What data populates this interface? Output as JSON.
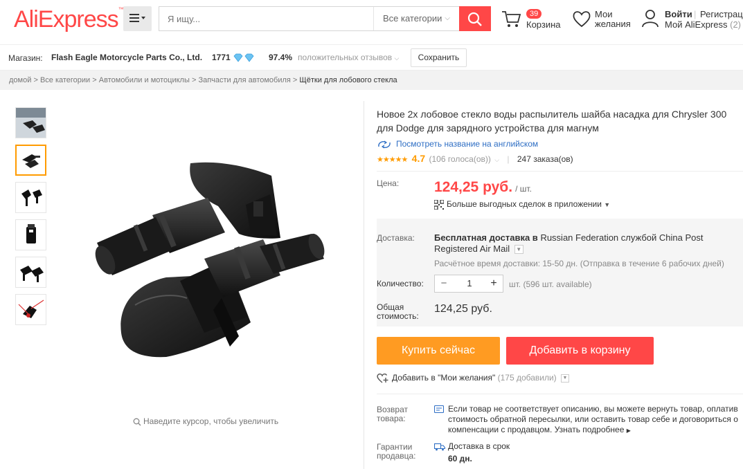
{
  "header": {
    "logo_text": "AliExpress",
    "logo_tm": "™",
    "search_placeholder": "Я ищу...",
    "category_select": "Все категории",
    "cart_count": "39",
    "cart_label": "Корзина",
    "wishlist_label_line1": "Мои",
    "wishlist_label_line2": "желания",
    "login_label": "Войти",
    "separator": "|",
    "register_label": "Регистрация",
    "my_aliexpress_label": "Мой AliExpress",
    "my_aliexpress_count": "(2)"
  },
  "store": {
    "label": "Магазин:",
    "name": "Flash Eagle Motorcycle Parts Co., Ltd.",
    "score": "1771",
    "positive_percent": "97.4%",
    "positive_label": "положительных отзывов",
    "save_label": "Сохранить"
  },
  "breadcrumb": {
    "items": [
      "домой",
      "Все категории",
      "Автомобили и мотоциклы",
      "Запчасти для автомобиля",
      "Щётки для лобового стекла"
    ],
    "separator": ">"
  },
  "gallery": {
    "zoom_hint": "Наведите курсор, чтобы увеличить"
  },
  "product": {
    "title": "Новое 2х лобовое стекло воды распылитель шайба насадка для Chrysler 300 для Dodge для зарядного устройства для магнум",
    "english_link": "Посмотреть название на английском",
    "rating": "4.7",
    "votes": "(106 голоса(ов))",
    "orders": "247 заказа(ов)",
    "price_label": "Цена:",
    "price": "124,25 руб.",
    "price_unit": "/ шт.",
    "app_deals": "Больше выгодных сделок в приложении",
    "delivery_label": "Доставка:",
    "delivery_free": "Бесплатная доставка в",
    "delivery_text": "Russian Federation службой China Post Registered Air Mail",
    "delivery_estimate": "Расчётное время доставки: 15-50 дн. (Отправка в течение 6 рабочих дней)",
    "quantity_label": "Количество:",
    "quantity_value": "1",
    "minus": "−",
    "plus": "+",
    "availability": "шт. (596 шт. available)",
    "total_label": "Общая стоимость:",
    "total_value": "124,25 руб.",
    "buy_now": "Купить сейчас",
    "add_to_cart": "Добавить в корзину",
    "wishlist_add": "Добавить в \"Мои желания\"",
    "wishlist_count": "(175 добавили)",
    "return_label": "Возврат товара:",
    "return_text": "Если товар не соответствует описанию, вы можете вернуть товар, оплатив стоимость обратной пересылки, или оставить товар себе и договориться о компенсации с продавцом.",
    "return_more": "Узнать подробнее",
    "guarantee_label": "Гарантии продавца:",
    "guarantee_text": "Доставка в срок",
    "guarantee_days": "60 дн."
  },
  "colors": {
    "brand": "#ff4747",
    "accent_orange": "#ff9b22",
    "link_blue": "#2e6ec4"
  }
}
